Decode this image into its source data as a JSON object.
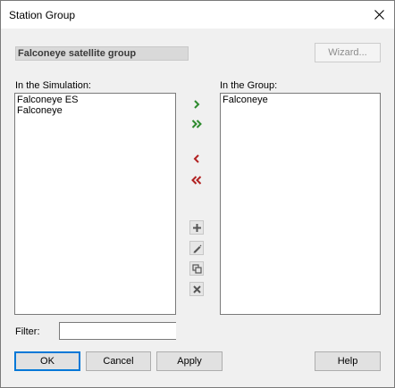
{
  "window": {
    "title": "Station Group",
    "close_icon": "close-icon"
  },
  "group_name": "Falconeye satellite group",
  "wizard_label": "Wizard...",
  "simulation": {
    "label": "In the Simulation:",
    "items": [
      "Falconeye ES",
      "Falconeye"
    ]
  },
  "group": {
    "label": "In the Group:",
    "items": [
      "Falconeye"
    ]
  },
  "icons": {
    "add_one": "chevron-right-icon",
    "add_all": "double-chevron-right-icon",
    "remove_one": "chevron-left-icon",
    "remove_all": "double-chevron-left-icon",
    "new": "plus-icon",
    "edit": "pencil-icon",
    "duplicate": "duplicate-icon",
    "delete": "x-icon"
  },
  "colors": {
    "add_arrow": "#2e8b2e",
    "remove_arrow": "#b22222",
    "default_button_border": "#0078d7"
  },
  "filter": {
    "label": "Filter:",
    "value": ""
  },
  "buttons": {
    "ok": "OK",
    "cancel": "Cancel",
    "apply": "Apply",
    "help": "Help"
  }
}
